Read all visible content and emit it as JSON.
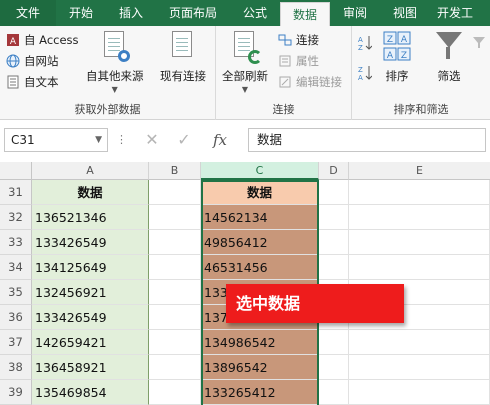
{
  "tabs": [
    "文件",
    "开始",
    "插入",
    "页面布局",
    "公式",
    "数据",
    "审阅",
    "视图",
    "开发工"
  ],
  "ribbon": {
    "get_external": {
      "access": "自 Access",
      "web": "自网站",
      "text": "自文本",
      "other_sources": "自其他来源",
      "existing_conn": "现有连接",
      "label": "获取外部数据"
    },
    "connections": {
      "refresh_all": "全部刷新",
      "connections": "连接",
      "properties": "属性",
      "edit_links": "编辑链接",
      "label": "连接"
    },
    "sort_filter": {
      "sort": "排序",
      "filter": "筛选",
      "label": "排序和筛选"
    }
  },
  "formula_bar": {
    "name_box": "C31",
    "content": "数据"
  },
  "columns": [
    "A",
    "B",
    "C",
    "D",
    "E"
  ],
  "rows": [
    {
      "num": "31",
      "a": "数据",
      "c": "数据"
    },
    {
      "num": "32",
      "a": "136521346",
      "c": "14562134"
    },
    {
      "num": "33",
      "a": "133426549",
      "c": "49856412"
    },
    {
      "num": "34",
      "a": "134125649",
      "c": "46531456"
    },
    {
      "num": "35",
      "a": "132456921",
      "c": "133"
    },
    {
      "num": "36",
      "a": "133426549",
      "c": "137"
    },
    {
      "num": "37",
      "a": "142659421",
      "c": "134986542"
    },
    {
      "num": "38",
      "a": "136458921",
      "c": "13896542"
    },
    {
      "num": "39",
      "a": "135469854",
      "c": "133265412"
    }
  ],
  "callout": "选中数据",
  "colors": {
    "excel_green": "#217346",
    "col_a_fill": "#e2efda",
    "col_c_header_fill": "#f8cbad",
    "col_c_fill": "#c8977a",
    "callout_red": "#ee1c1c"
  }
}
